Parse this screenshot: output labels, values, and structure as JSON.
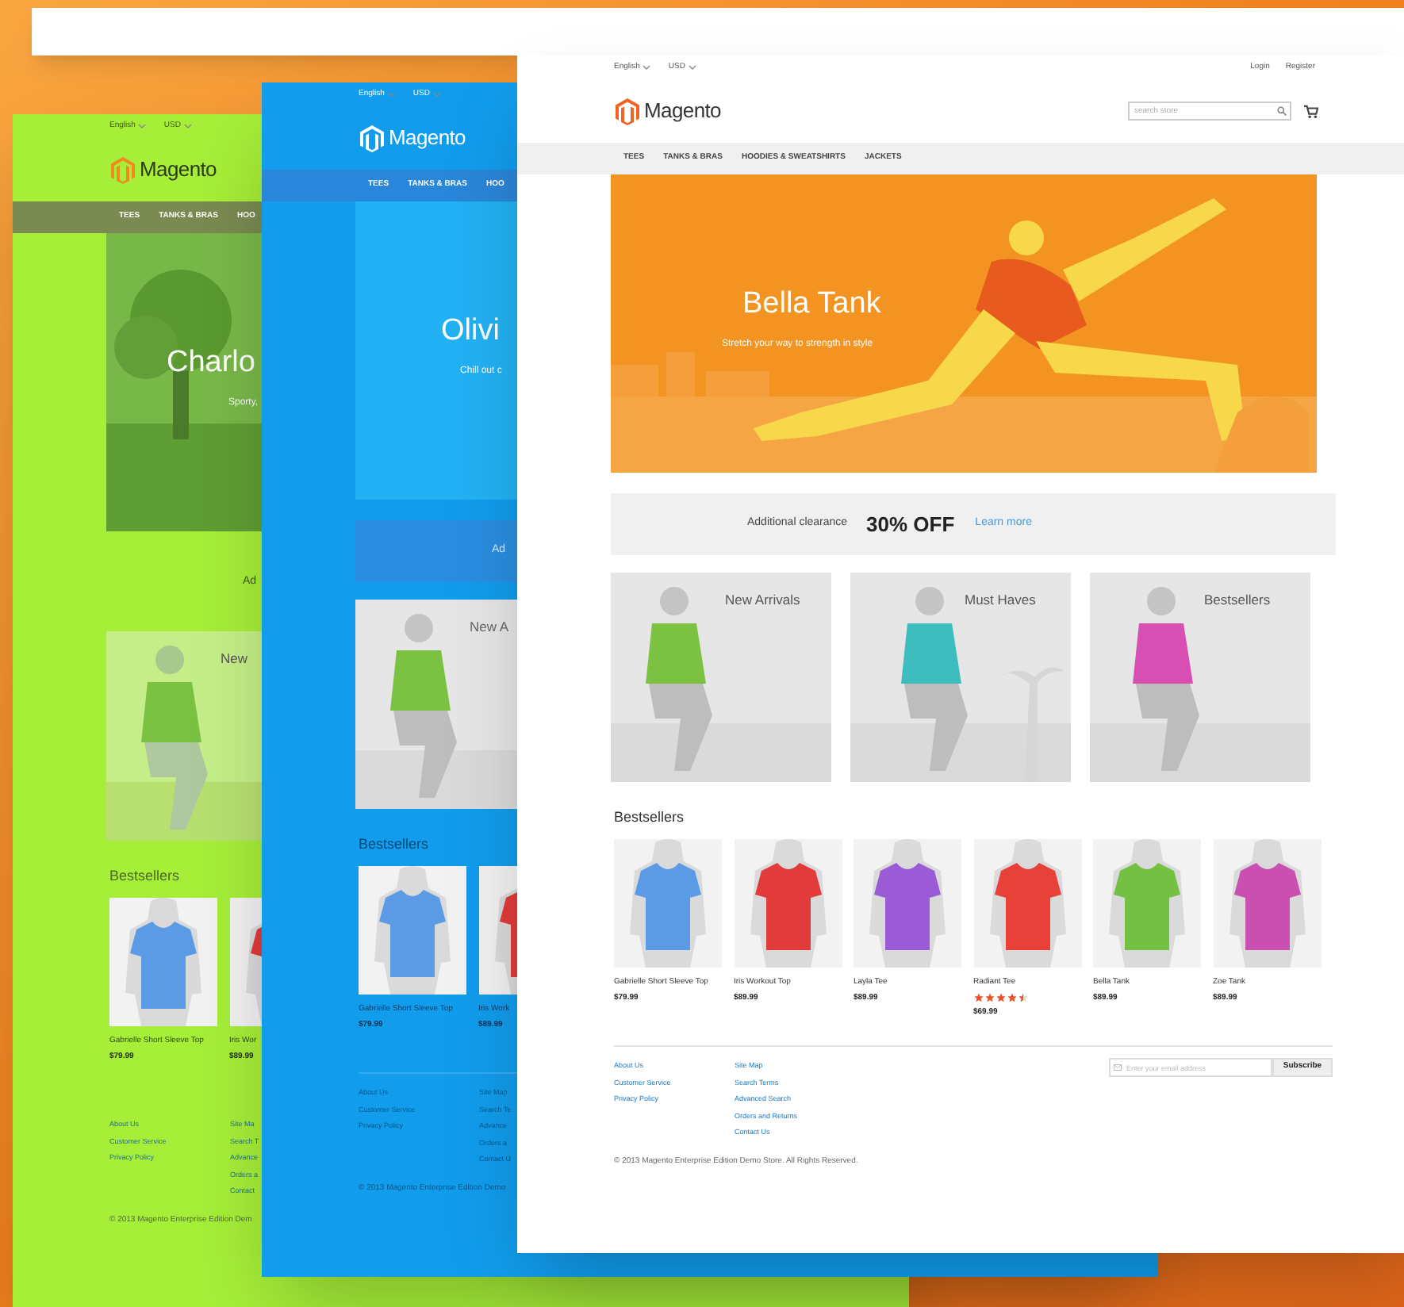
{
  "pages": [
    {
      "kind": "green",
      "top_bar": {
        "language": "English",
        "currency": "USD"
      },
      "logo": "Magento",
      "nav": [
        "TEES",
        "TANKS & BRAS",
        "HOO"
      ],
      "hero": {
        "title": "Charlo",
        "subtitle": "Sporty,"
      },
      "promo": {
        "text": "Ad"
      },
      "tiles": [
        {
          "label": "New"
        }
      ],
      "bestsellers": {
        "heading": "Bestsellers",
        "products": [
          {
            "name": "Gabrielle Short Sleeve Top",
            "price": "$79.99"
          },
          {
            "name": "Iris Wor",
            "price": "$89.99"
          }
        ]
      },
      "footer": {
        "columns": [
          [
            "About Us",
            "Customer Service",
            "Privacy Policy"
          ],
          [
            "Site Ma",
            "Search T",
            "Advance",
            "Orders a",
            "Contact"
          ]
        ],
        "copyright": "© 2013 Magento Enterprise Edition Dem"
      }
    },
    {
      "kind": "blue",
      "top_bar": {
        "language": "English",
        "currency": "USD"
      },
      "logo": "Magento",
      "nav": [
        "TEES",
        "TANKS & BRAS",
        "HOO"
      ],
      "hero": {
        "title": "Olivi",
        "subtitle": "Chill out c"
      },
      "promo": {
        "text": "Ad"
      },
      "tiles": [
        {
          "label": "New A"
        }
      ],
      "bestsellers": {
        "heading": "Bestsellers",
        "products": [
          {
            "name": "Gabrielle Short Sleeve Top",
            "price": "$79.99"
          },
          {
            "name": "Iris Work",
            "price": "$89.99"
          }
        ]
      },
      "footer": {
        "columns": [
          [
            "About Us",
            "Customer Service",
            "Privacy Policy"
          ],
          [
            "Site Map",
            "Search Te",
            "Advance",
            "Orders a",
            "Contact U"
          ]
        ],
        "copyright": "© 2013 Magento Enterprise Edition Demo"
      }
    },
    {
      "kind": "white",
      "top_bar": {
        "language": "English",
        "currency": "USD"
      },
      "account_links": [
        "Login",
        "Register"
      ],
      "logo": "Magento",
      "search": {
        "placeholder": "search store"
      },
      "nav": [
        "TEES",
        "TANKS & BRAS",
        "HOODIES & SWEATSHIRTS",
        "JACKETS"
      ],
      "hero": {
        "title": "Bella Tank",
        "subtitle": "Stretch your way to strength in style"
      },
      "promo": {
        "text": "Additional clearance",
        "highlight": "30% OFF",
        "link": "Learn more"
      },
      "tiles": [
        {
          "label": "New Arrivals"
        },
        {
          "label": "Must Haves"
        },
        {
          "label": "Bestsellers"
        }
      ],
      "bestsellers": {
        "heading": "Bestsellers",
        "products": [
          {
            "name": "Gabrielle Short Sleeve Top",
            "price": "$79.99"
          },
          {
            "name": "Iris Workout Top",
            "price": "$89.99"
          },
          {
            "name": "Layla Tee",
            "price": "$89.99"
          },
          {
            "name": "Radiant Tee",
            "stars": 4.5,
            "price": "$69.99"
          },
          {
            "name": "Bella Tank",
            "price": "$89.99"
          },
          {
            "name": "Zoe Tank",
            "price": "$89.99"
          }
        ]
      },
      "footer": {
        "columns": [
          [
            "About Us",
            "Customer Service",
            "Privacy Policy"
          ],
          [
            "Site Map",
            "Search Terms",
            "Advanced Search",
            "Orders and Returns",
            "Contact Us"
          ]
        ],
        "newsletter": {
          "placeholder": "Enter your email address",
          "button": "Subscribe"
        },
        "copyright": "© 2013 Magento Enterprise Edition Demo Store. All Rights Reserved."
      }
    }
  ]
}
